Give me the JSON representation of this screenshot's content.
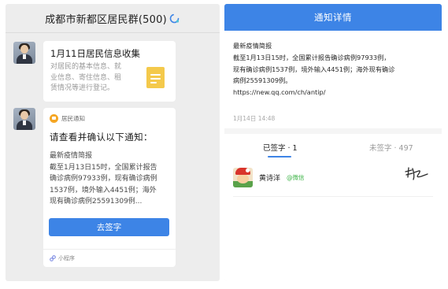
{
  "left_panel": {
    "title": "成都市新都区居民群(500)",
    "messages": [
      {
        "type": "form_card",
        "title": "1月11日居民信息收集",
        "description_lines": [
          "对居民的基本信息、就",
          "业信息、寄住信息、租",
          "赁情况等进行登记。"
        ],
        "icon": "document-icon"
      },
      {
        "type": "notice_card",
        "source": "居民通知",
        "title": "请查看并确认以下通知：",
        "body_lines": [
          "最新疫情简报",
          "截至1月13日15时，全国累计报告",
          "确诊病例97933例，现有确诊病例",
          "1537例，境外输入4451例；海外",
          "现有确诊病例25591309例..."
        ],
        "button_label": "去签字",
        "footer": "小程序"
      }
    ]
  },
  "right_panel": {
    "title": "通知详情",
    "notice_lines": [
      "最新疫情简报",
      "截至1月13日15时，全国累计报告确诊病例97933例，",
      "现有确诊病例1537例，境外输入4451例；海外现有确诊",
      "病例25591309例。",
      "https://new.qq.com/ch/antip/"
    ],
    "date": "1月14日 14:48",
    "tabs": {
      "signed": "已签字 · 1",
      "unsigned": "未签字 · 497"
    },
    "signers": [
      {
        "name": "黄诗洋",
        "tag": "@微信"
      }
    ]
  },
  "colors": {
    "accent": "#3d84e6",
    "wechat_green": "#3fb449",
    "doc_icon": "#f4c94b",
    "source_icon": "#f5a623"
  }
}
